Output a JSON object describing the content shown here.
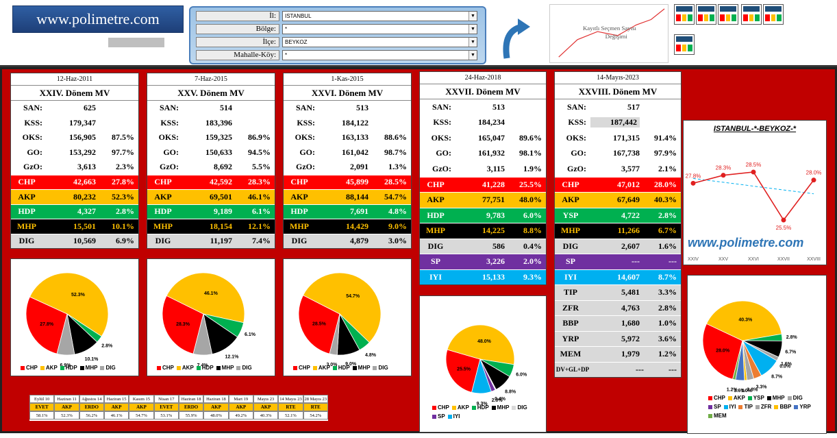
{
  "header": {
    "brand": "www.polimetre.com",
    "filters": [
      {
        "label": "İl:",
        "value": "ISTANBUL"
      },
      {
        "label": "Bölge:",
        "value": "*"
      },
      {
        "label": "İlçe:",
        "value": "BEYKOZ"
      },
      {
        "label": "Mahalle-Köy:",
        "value": "*"
      }
    ],
    "trend_thumb_label": "Kayıtlı Seçmen Sayısı Değişimi"
  },
  "colors": {
    "CHP": "#ff0000",
    "AKP": "#ffc000",
    "HDP": "#00b050",
    "YSP": "#00b050",
    "MHP": "#000000",
    "DIG": "#d9d9d9",
    "SP": "#7030a0",
    "IYI": "#00b0f0"
  },
  "elections": [
    {
      "date": "12-Haz-2011",
      "title": "XXIV. Dönem MV",
      "stats": [
        {
          "l": "SAN:",
          "v": "625",
          "p": ""
        },
        {
          "l": "KSS:",
          "v": "179,347",
          "p": ""
        },
        {
          "l": "OKS:",
          "v": "156,905",
          "p": "87.5%"
        },
        {
          "l": "GO:",
          "v": "153,292",
          "p": "97.7%"
        },
        {
          "l": "GzO:",
          "v": "3,613",
          "p": "2.3%"
        }
      ],
      "parties": [
        {
          "n": "CHP",
          "v": "42,663",
          "p": "27.8%"
        },
        {
          "n": "AKP",
          "v": "80,232",
          "p": "52.3%"
        },
        {
          "n": "HDP",
          "v": "4,327",
          "p": "2.8%"
        },
        {
          "n": "MHP",
          "v": "15,501",
          "p": "10.1%"
        },
        {
          "n": "DIG",
          "v": "10,569",
          "p": "6.9%"
        }
      ]
    },
    {
      "date": "7-Haz-2015",
      "title": "XXV. Dönem MV",
      "stats": [
        {
          "l": "SAN:",
          "v": "514",
          "p": ""
        },
        {
          "l": "KSS:",
          "v": "183,396",
          "p": ""
        },
        {
          "l": "OKS:",
          "v": "159,325",
          "p": "86.9%"
        },
        {
          "l": "GO:",
          "v": "150,633",
          "p": "94.5%"
        },
        {
          "l": "GzO:",
          "v": "8,692",
          "p": "5.5%"
        }
      ],
      "parties": [
        {
          "n": "CHP",
          "v": "42,592",
          "p": "28.3%"
        },
        {
          "n": "AKP",
          "v": "69,501",
          "p": "46.1%"
        },
        {
          "n": "HDP",
          "v": "9,189",
          "p": "6.1%"
        },
        {
          "n": "MHP",
          "v": "18,154",
          "p": "12.1%"
        },
        {
          "n": "DIG",
          "v": "11,197",
          "p": "7.4%"
        }
      ]
    },
    {
      "date": "1-Kas-2015",
      "title": "XXVI. Dönem MV",
      "stats": [
        {
          "l": "SAN:",
          "v": "513",
          "p": ""
        },
        {
          "l": "KSS:",
          "v": "184,122",
          "p": ""
        },
        {
          "l": "OKS:",
          "v": "163,133",
          "p": "88.6%"
        },
        {
          "l": "GO:",
          "v": "161,042",
          "p": "98.7%"
        },
        {
          "l": "GzO:",
          "v": "2,091",
          "p": "1.3%"
        }
      ],
      "parties": [
        {
          "n": "CHP",
          "v": "45,899",
          "p": "28.5%"
        },
        {
          "n": "AKP",
          "v": "88,144",
          "p": "54.7%"
        },
        {
          "n": "HDP",
          "v": "7,691",
          "p": "4.8%"
        },
        {
          "n": "MHP",
          "v": "14,429",
          "p": "9.0%"
        },
        {
          "n": "DIG",
          "v": "4,879",
          "p": "3.0%"
        }
      ]
    },
    {
      "date": "24-Haz-2018",
      "title": "XXVII. Dönem MV",
      "stats": [
        {
          "l": "SAN:",
          "v": "513",
          "p": ""
        },
        {
          "l": "KSS:",
          "v": "184,234",
          "p": ""
        },
        {
          "l": "OKS:",
          "v": "165,047",
          "p": "89.6%"
        },
        {
          "l": "GO:",
          "v": "161,932",
          "p": "98.1%"
        },
        {
          "l": "GzO:",
          "v": "3,115",
          "p": "1.9%"
        }
      ],
      "parties": [
        {
          "n": "CHP",
          "v": "41,228",
          "p": "25.5%"
        },
        {
          "n": "AKP",
          "v": "77,751",
          "p": "48.0%"
        },
        {
          "n": "HDP",
          "v": "9,783",
          "p": "6.0%"
        },
        {
          "n": "MHP",
          "v": "14,225",
          "p": "8.8%"
        },
        {
          "n": "DIG",
          "v": "586",
          "p": "0.4%"
        },
        {
          "n": "SP",
          "v": "3,226",
          "p": "2.0%"
        },
        {
          "n": "IYI",
          "v": "15,133",
          "p": "9.3%"
        }
      ]
    },
    {
      "date": "14-Mayıs-2023",
      "title": "XXVIII. Dönem MV",
      "stats": [
        {
          "l": "SAN:",
          "v": "517",
          "p": ""
        },
        {
          "l": "KSS:",
          "v": "187,442",
          "p": ""
        },
        {
          "l": "OKS:",
          "v": "171,315",
          "p": "91.4%"
        },
        {
          "l": "GO:",
          "v": "167,738",
          "p": "97.9%"
        },
        {
          "l": "GzO:",
          "v": "3,577",
          "p": "2.1%"
        }
      ],
      "parties": [
        {
          "n": "CHP",
          "v": "47,012",
          "p": "28.0%"
        },
        {
          "n": "AKP",
          "v": "67,649",
          "p": "40.3%"
        },
        {
          "n": "YSP",
          "v": "4,722",
          "p": "2.8%"
        },
        {
          "n": "MHP",
          "v": "11,266",
          "p": "6.7%"
        },
        {
          "n": "DIG",
          "v": "2,607",
          "p": "1.6%"
        },
        {
          "n": "SP",
          "v": "---",
          "p": "---"
        },
        {
          "n": "IYI",
          "v": "14,607",
          "p": "8.7%"
        },
        {
          "n": "TIP",
          "v": "5,481",
          "p": "3.3%"
        },
        {
          "n": "ZFR",
          "v": "4,763",
          "p": "2.8%"
        },
        {
          "n": "BBP",
          "v": "1,680",
          "p": "1.0%"
        },
        {
          "n": "YRP",
          "v": "5,972",
          "p": "3.6%"
        },
        {
          "n": "MEM",
          "v": "1,979",
          "p": "1.2%"
        },
        {
          "n": "DV+GL+DP",
          "v": "---",
          "p": "---"
        }
      ]
    }
  ],
  "pies": [
    {
      "slices": [
        {
          "n": "CHP",
          "p": 27.8,
          "c": "#ff0000"
        },
        {
          "n": "AKP",
          "p": 52.3,
          "c": "#ffc000"
        },
        {
          "n": "HDP",
          "p": 2.8,
          "c": "#00b050"
        },
        {
          "n": "MHP",
          "p": 10.1,
          "c": "#000000"
        },
        {
          "n": "DIG",
          "p": 6.9,
          "c": "#a6a6a6"
        }
      ],
      "legend": [
        "CHP",
        "AKP",
        "HDP",
        "MHP",
        "DIG"
      ]
    },
    {
      "slices": [
        {
          "n": "CHP",
          "p": 28.3,
          "c": "#ff0000"
        },
        {
          "n": "AKP",
          "p": 46.1,
          "c": "#ffc000"
        },
        {
          "n": "HDP",
          "p": 6.1,
          "c": "#00b050"
        },
        {
          "n": "MHP",
          "p": 12.1,
          "c": "#000000"
        },
        {
          "n": "DIG",
          "p": 7.4,
          "c": "#a6a6a6"
        }
      ],
      "legend": [
        "CHP",
        "AKP",
        "HDP",
        "MHP",
        "DIG"
      ]
    },
    {
      "slices": [
        {
          "n": "CHP",
          "p": 28.5,
          "c": "#ff0000"
        },
        {
          "n": "AKP",
          "p": 54.7,
          "c": "#ffc000"
        },
        {
          "n": "HDP",
          "p": 4.8,
          "c": "#00b050"
        },
        {
          "n": "MHP",
          "p": 9.0,
          "c": "#000000"
        },
        {
          "n": "DIG",
          "p": 3.0,
          "c": "#a6a6a6"
        }
      ],
      "legend": [
        "CHP",
        "AKP",
        "HDP",
        "MHP",
        "DIG"
      ]
    },
    {
      "slices": [
        {
          "n": "CHP",
          "p": 25.5,
          "c": "#ff0000"
        },
        {
          "n": "AKP",
          "p": 48.0,
          "c": "#ffc000"
        },
        {
          "n": "HDP",
          "p": 6.0,
          "c": "#00b050"
        },
        {
          "n": "MHP",
          "p": 8.8,
          "c": "#000000"
        },
        {
          "n": "DIG",
          "p": 0.4,
          "c": "#d9d9d9"
        },
        {
          "n": "SP",
          "p": 2.0,
          "c": "#7030a0"
        },
        {
          "n": "IYI",
          "p": 9.3,
          "c": "#00b0f0"
        }
      ],
      "legend": [
        "CHP",
        "AKP",
        "HDP",
        "MHP",
        "DIG",
        "SP",
        "IYI"
      ]
    },
    {
      "slices": [
        {
          "n": "CHP",
          "p": 28.0,
          "c": "#ff0000"
        },
        {
          "n": "AKP",
          "p": 40.3,
          "c": "#ffc000"
        },
        {
          "n": "YSP",
          "p": 2.8,
          "c": "#00b050"
        },
        {
          "n": "MHP",
          "p": 6.7,
          "c": "#000000"
        },
        {
          "n": "DIG",
          "p": 1.6,
          "c": "#a6a6a6"
        },
        {
          "n": "SP",
          "p": 0.0,
          "c": "#7030a0"
        },
        {
          "n": "IYI",
          "p": 8.7,
          "c": "#00b0f0"
        },
        {
          "n": "TIP",
          "p": 3.3,
          "c": "#ed7d31"
        },
        {
          "n": "ZFR",
          "p": 2.8,
          "c": "#a5a5a5"
        },
        {
          "n": "BBP",
          "p": 1.0,
          "c": "#ffc000"
        },
        {
          "n": "YRP",
          "p": 3.6,
          "c": "#4472c4"
        },
        {
          "n": "MEM",
          "p": 1.2,
          "c": "#70ad47"
        }
      ],
      "legend": [
        "CHP",
        "AKP",
        "YSP",
        "MHP",
        "DIG",
        "SP",
        "IYI",
        "TIP",
        "ZFR",
        "BBP",
        "YRP",
        "MEM"
      ]
    }
  ],
  "months": {
    "top": [
      "Eylül 10",
      "Haziran 11",
      "Ağustos 14",
      "Haziran 15",
      "Kasım 15",
      "Nisan 17",
      "Haziran 18",
      "Haziran 18",
      "Mart 19",
      "Mayıs 23",
      "14 Mayıs 23",
      "28 Mayıs 23"
    ],
    "mid": [
      "EVET",
      "AKP",
      "ERDO",
      "AKP",
      "AKP",
      "EVET",
      "ERDO",
      "AKP",
      "AKP",
      "AKP",
      "RTE",
      "RTE"
    ],
    "bot": [
      "58.1%",
      "52.3%",
      "56.2%",
      "46.1%",
      "54.7%",
      "53.1%",
      "55.9%",
      "48.0%",
      "49.2%",
      "40.3%",
      "52.1%",
      "54.2%"
    ]
  },
  "chart_data": {
    "type": "line",
    "title": "ISTANBUL-*-BEYKOZ-*",
    "categories": [
      "XXIV",
      "XXV",
      "XXVI",
      "XXVII",
      "XXVIII"
    ],
    "values": [
      27.8,
      28.3,
      28.5,
      25.5,
      28.0
    ],
    "labels": [
      "27.8%",
      "28.3%",
      "28.5%",
      "25.5%",
      "28.0%"
    ],
    "trendline": true,
    "watermark": "www.polimetre.com"
  }
}
